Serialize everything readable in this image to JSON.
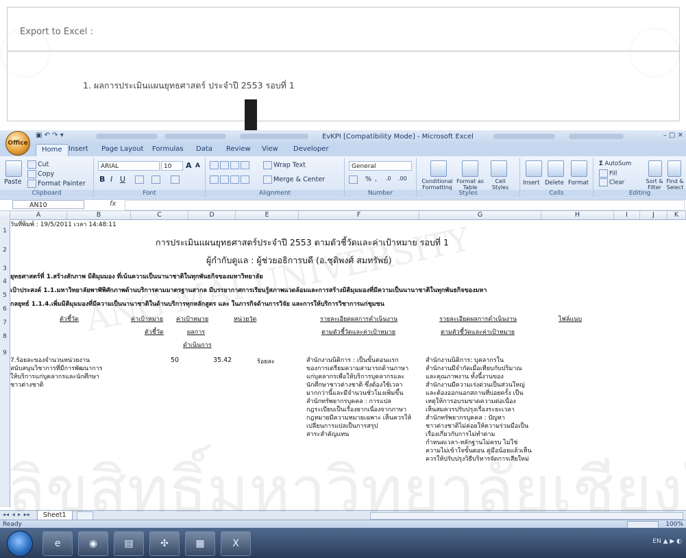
{
  "export_panel": {
    "title": "Export to Excel :",
    "item": "1. ผลการประเมินแผนยุทธศาสตร์ ประจำปี 2553 รอบที่ 1"
  },
  "excel": {
    "title": "EvKPI [Compatibility Mode] - Microsoft Excel",
    "office_button": "Office",
    "quick_access": "▣ ↶ ↷ ▾",
    "window_controls": "–  ▢  ✕",
    "tabs": [
      "Home",
      "Insert",
      "Page Layout",
      "Formulas",
      "Data",
      "Review",
      "View",
      "Developer"
    ],
    "ribbon": {
      "clipboard": {
        "label": "Clipboard",
        "paste": "Paste",
        "cut": "Cut",
        "copy": "Copy",
        "format_painter": "Format Painter"
      },
      "font": {
        "label": "Font",
        "name": "ARIAL",
        "size": "10",
        "bold": "B",
        "italic": "I",
        "underline": "U",
        "grow": "A",
        "shrink": "A"
      },
      "alignment": {
        "label": "Alignment",
        "wrap_text": "Wrap Text",
        "merge_center": "Merge & Center"
      },
      "number": {
        "label": "Number",
        "format": "General",
        "percent": "%",
        "comma": ",",
        "inc_dec": ".0",
        "dec_dec": ".00"
      },
      "styles": {
        "label": "Styles",
        "conditional": "Conditional Formatting",
        "format_table": "Format as Table",
        "cell_styles": "Cell Styles"
      },
      "cells": {
        "label": "Cells",
        "insert": "Insert",
        "delete": "Delete",
        "format": "Format"
      },
      "editing": {
        "label": "Editing",
        "autosum": "AutoSum",
        "fill": "Fill",
        "clear": "Clear",
        "sort_filter": "Sort & Filter",
        "find_select": "Find & Select"
      }
    },
    "name_box": "AN10",
    "fx": "fx",
    "columns": [
      "A",
      "B",
      "C",
      "D",
      "E",
      "F",
      "G",
      "H",
      "I",
      "J",
      "K"
    ],
    "rows": [
      "1",
      "2",
      "3",
      "4",
      "5",
      "6",
      "7",
      "8",
      "9"
    ],
    "sheet": {
      "printed_date": "วันที่พิมพ์ : 19/5/2011 เวลา 14:48:11",
      "heading": "การประเมินแผนยุทธศาสตร์ประจำปี 2553 ตามตัวชี้วัดและค่าเป้าหมาย รอบที่ 1",
      "subheading": "ผู้กำกับดูแล : ผู้ช่วยอธิการบดี (อ.ชุติพงศ์ สมทรัพย์)",
      "strategy": "ยุทธศาสตร์ที่ 1.สร้างสักภาพ มิติมุมมอง ที่เน้นความเป็นนานาชาติในทุกพันธกิจของมหาวิทยาลัย",
      "goal": "เป้าประสงค์ 1.1.มหาวิทยาลัยพาฬัพิศักภาพด้านบริการตามมาตรฐานสากล มีบรรยากาศการเรียนรู้สภาพแวดล้อมและการสร้างมิติมุมมองที่มีความเป็นนานาชาติในทุกพันธกิจของมหา",
      "tactic": "กลยุทธ์     1.1.4.เพิ่มมิติมุมมองที่มีความเป็นนานาชาติในด้านบริการทุกหลักสูตร และ ในภารกิจด้านการวิจัย และการให้บริการวิชาการแก่ชุมชน",
      "headers": {
        "indicator": "ตัวชี้วัด",
        "target_indicator_1": "ค่าเป้าหมาย",
        "target_indicator_2": "ตัวชี้วัด",
        "target_result_1": "ค่าเป้าหมาย",
        "target_result_2": "ผลการ",
        "target_result_3": "ดำเนินการ",
        "unit": "หน่วยวัด",
        "detail_1a": "รายละเอียดผลการดำเนินงาน",
        "detail_1b": "ตามตัวชี้วัดและค่าเป้าหมาย",
        "detail_2a": "รายละเอียดผลการดำเนินงาน",
        "detail_2b": "ตามตัวชี้วัดและค่าเป้าหมาย",
        "attachment": "ไฟล์แนบ"
      },
      "row9": {
        "indicator": "7.ร้อยละของจำนวนหน่วยงาน\nสนับสนุนวิชาการที่มีการพัฒนาการ\nให้บริการแก่บุคลากรและนักศึกษา\nชาวต่างชาติ",
        "target": "50",
        "result": "35.42",
        "unit": "ร้อยละ",
        "detail_f": "สำนักงานนิติการ : เป็นขั้นตอนแรก\nของการเตรียมความสามารถด้านภาษา\nแก่บุคลากรเพื่อให้บริการบุคลากรและ\nนักศึกษาชาวต่างชาติ ซึ่งต้องใช้เวลา\nมากกว่านี้และมีจำนวนชั่วโมงเพิ่มขึ้น\nสำนักทรัพยากรบุคคล : การแปล\nกฎระเบียบเป็นเรื่องยากเนื่องจากภาษา\nกฎหมายมีความหมายเฉพาะ เห็นควรให้\nเปลี่ยนการแปลเป็นการสรุป\nสาระสำคัญแทน",
        "detail_g": "สำนักงานนิติการ: บุคลากรใน\nสำนักงานมีจำกัดเมื่อเทียบกับปริมาณ\nและคุณภาพงาน ทั้งนี้งานของ\nสำนักงานมีความเร่งด่วนเป็นส่วนใหญ่\nและต้องออกนอกสถานที่บ่อยครั้ง เป็น\nเหตุให้การอบรมขาดความต่อเนื่อง\nเห็นสมควรปรับปรุงเรื่องระยะเวลา\nสำนักทรัพยากรบุคคล : ปัญหา\nชาวต่างชาติไม่ค่อยให้ความร่วมมือเป็น\nเรื่องเกี่ยวกับการไม่ทำตาม\nกำหนดเวลา-หลักฐานไม่ครบ ไม่ใช่\nความไม่เข้าใจขั้นตอน คู่มือน้อยแล้วเห็น\nควรให้ปรับปรุงวิธีบริหารจัดการเสียใหม่"
      }
    },
    "sheet_tab": "Sheet1",
    "sheet_nav": "◂◂ ◂ ▸ ▸▸",
    "status": "Ready",
    "zoom": "100%"
  },
  "taskbar": {
    "tray": "EN  ▲  ▶  ◐",
    "buttons": [
      "e",
      "◉",
      "▤",
      "✣",
      "▦",
      "X"
    ]
  },
  "watermark": {
    "line1": "ลิขสิทธิ์มหาวิทยาลัยเชียงใหม่",
    "line2": "ANG   MAI   UNIVERSITY"
  }
}
